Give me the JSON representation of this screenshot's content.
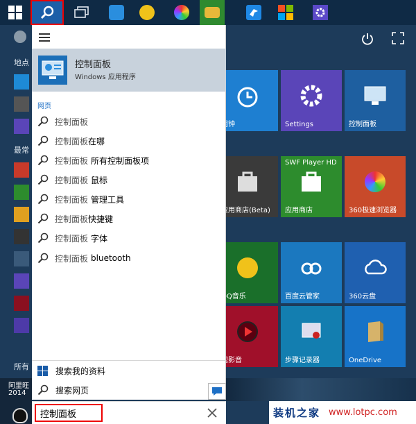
{
  "taskbar": {
    "apps": [
      {
        "icon": "file-explorer-icon",
        "color": "#e0e6ee"
      },
      {
        "icon": "cloud-drive-icon",
        "color": "#2a8ede"
      },
      {
        "icon": "qq-music-icon",
        "color": "#f0c21a"
      },
      {
        "icon": "browser-360-icon",
        "color": "#3aa33a"
      },
      {
        "icon": "folder-icon",
        "color": "#e8b83a"
      },
      {
        "icon": "bird-app-icon",
        "color": "#1e88e5"
      },
      {
        "icon": "store-icon",
        "color": "#f25022"
      },
      {
        "icon": "settings-icon",
        "color": "#5b49c8"
      }
    ]
  },
  "left_column": {
    "places_label": "地点",
    "frequent_label": "最常",
    "all_apps_label": "所有"
  },
  "search_panel": {
    "best_match": {
      "title": "控制面板",
      "subtitle": "Windows 应用程序"
    },
    "section_web": "网页",
    "suggestions": [
      {
        "query": "控制面板",
        "rest": ""
      },
      {
        "query": "控制面板",
        "rest": "在哪"
      },
      {
        "query": "控制面板",
        "rest": "所有控制面板项"
      },
      {
        "query": "控制面板",
        "rest": "鼠标"
      },
      {
        "query": "控制面板",
        "rest": "管理工具"
      },
      {
        "query": "控制面板",
        "rest": "快捷键"
      },
      {
        "query": "控制面板",
        "rest": "字体"
      },
      {
        "query": "控制面板",
        "rest": "bluetooth"
      }
    ],
    "search_my_stuff": "搜索我的资料",
    "search_web": "搜索网页"
  },
  "search_box": {
    "value": "控制面板"
  },
  "tiles": [
    {
      "label": "闹钟",
      "color": "#1e7fd1"
    },
    {
      "label": "Settings",
      "color": "#5a45b8"
    },
    {
      "label": "控制面板",
      "color": "#1e5fa0"
    },
    {
      "label": "应用商店(Beta)",
      "color": "#3a3a3a"
    },
    {
      "label": "应用商店",
      "color": "#2d8c2d"
    },
    {
      "label": "360极速浏览器",
      "color": "#c84a2a"
    },
    {
      "label": "QQ音乐",
      "color": "#1a6f2a"
    },
    {
      "label": "百度云管家",
      "color": "#1b78bf"
    },
    {
      "label": "360云盘",
      "color": "#1f60b0"
    },
    {
      "label": "视影音",
      "color": "#a0102a"
    },
    {
      "label": "步骤记录器",
      "color": "#137eb0"
    },
    {
      "label": "OneDrive",
      "color": "#1773c8"
    }
  ],
  "swf_tile_header": "SWF Player HD",
  "desktop": {
    "qq_line1": "阿里旺",
    "qq_line2": "2014"
  },
  "watermark": {
    "main": "装机之家",
    "url": "www.lotpc.com"
  }
}
